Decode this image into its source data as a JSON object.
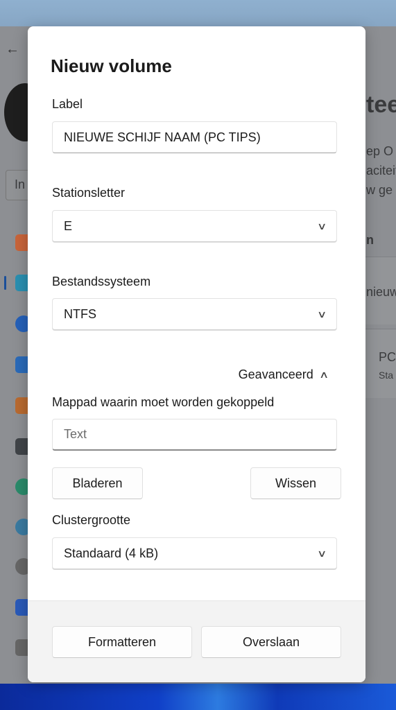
{
  "background": {
    "fragments": [
      "In",
      "tee",
      "ep O",
      "aciteit",
      "w ge",
      "n",
      "nieuw",
      "PC",
      "Sta"
    ]
  },
  "dialog": {
    "title": "Nieuw volume",
    "label_field": {
      "label": "Label",
      "value": "NIEUWE SCHIJF NAAM (PC TIPS)"
    },
    "drive_letter": {
      "label": "Stationsletter",
      "value": "E"
    },
    "file_system": {
      "label": "Bestandssysteem",
      "value": "NTFS"
    },
    "advanced": {
      "label": "Geavanceerd",
      "expanded": true
    },
    "mount_path": {
      "label": "Mappad waarin moet worden gekoppeld",
      "placeholder": "Text",
      "value": ""
    },
    "browse_label": "Bladeren",
    "clear_label": "Wissen",
    "cluster_size": {
      "label": "Clustergrootte",
      "value": "Standaard (4 kB)"
    },
    "format_label": "Formatteren",
    "skip_label": "Overslaan"
  }
}
